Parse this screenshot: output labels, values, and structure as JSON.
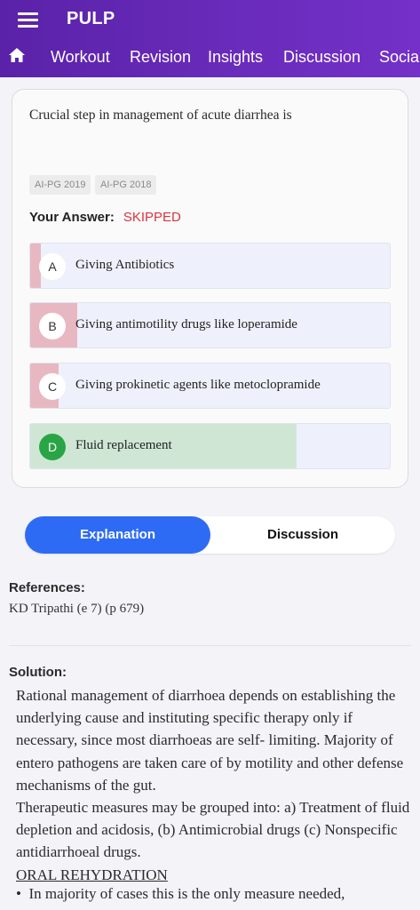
{
  "app": {
    "title": "PULP"
  },
  "nav": {
    "items": [
      "Workout",
      "Revision",
      "Insights",
      "Discussion",
      "Social"
    ]
  },
  "question": {
    "text": "Crucial step in management of acute diarrhea is",
    "tags": [
      "AI-PG 2019",
      "AI-PG 2018"
    ],
    "your_answer_label": "Your Answer:",
    "your_answer_value": "SKIPPED",
    "options": [
      {
        "letter": "A",
        "text": "Giving Antibiotics",
        "percent": 3
      },
      {
        "letter": "B",
        "text": "Giving antimotility drugs like loperamide",
        "percent": 13
      },
      {
        "letter": "C",
        "text": "Giving prokinetic agents like metoclopramide",
        "percent": 8
      },
      {
        "letter": "D",
        "text": "Fluid replacement",
        "percent": 74,
        "correct": true
      }
    ]
  },
  "tabs": {
    "explanation": "Explanation",
    "discussion": "Discussion"
  },
  "references": {
    "label": "References:",
    "text": "KD Tripathi (e 7) (p 679)"
  },
  "solution": {
    "label": "Solution:",
    "para1": "Rational management of diarrhoea depends on establishing the underlying cause and instituting specific therapy only if necessary, since most diarrhoeas are self- limiting. Majority of entero pathogens are taken care of by motility and other defense mechanisms of the gut.",
    "para2": "Therapeutic measures may be grouped into: a) Treatment of fluid depletion and acidosis, (b) Antimicrobial drugs (c) Nonspecific antidiarrhoeal drugs.",
    "heading": "ORAL REHYDRATION",
    "bullet": "In majority of cases this is the only measure needed,"
  },
  "colors": {
    "primary": "#6a2cbc",
    "accent": "#2e6bf5",
    "wrong_fill": "#e8b8c2",
    "correct_fill": "#cfe6d5",
    "correct_badge": "#2aa545",
    "skipped": "#d8343f"
  }
}
